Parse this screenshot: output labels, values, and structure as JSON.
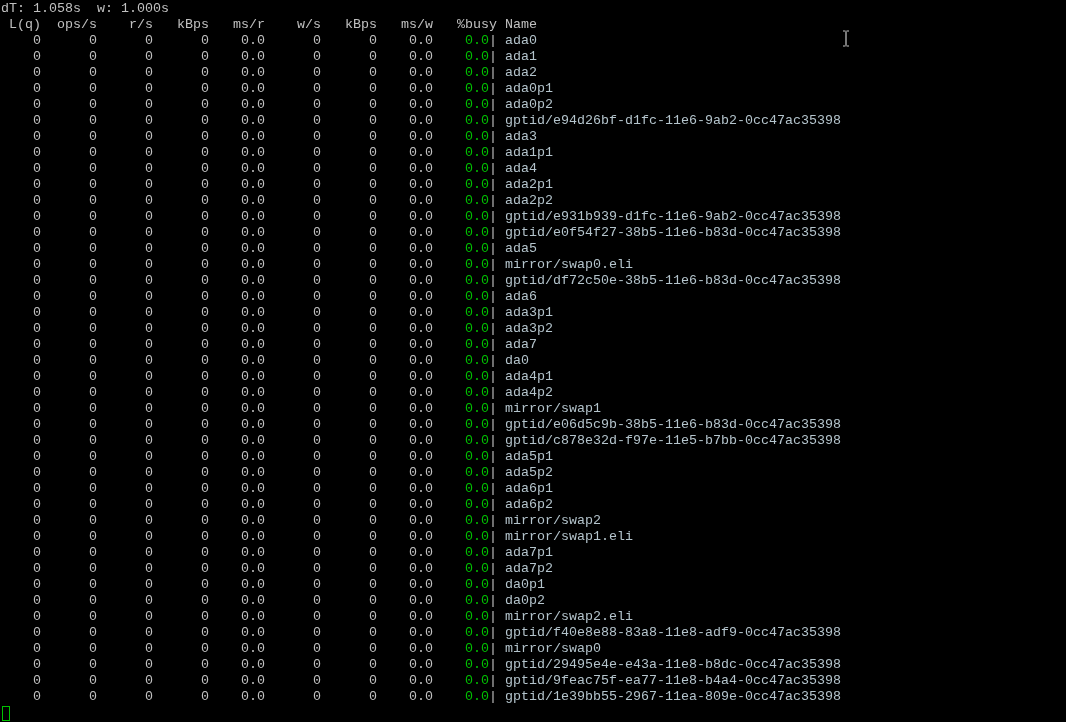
{
  "status_line": {
    "interval": "dT: 1.058s",
    "window": "w: 1.000s"
  },
  "columns": [
    "L(q)",
    "ops/s",
    "r/s",
    "kBps",
    "ms/r",
    "w/s",
    "kBps",
    "ms/w",
    "%busy",
    "Name"
  ],
  "rows": [
    {
      "cells": [
        "0",
        "0",
        "0",
        "0",
        "0.0",
        "0",
        "0",
        "0.0",
        "0.0"
      ],
      "sep": "|",
      "name": "ada0"
    },
    {
      "cells": [
        "0",
        "0",
        "0",
        "0",
        "0.0",
        "0",
        "0",
        "0.0",
        "0.0"
      ],
      "sep": "|",
      "name": "ada1"
    },
    {
      "cells": [
        "0",
        "0",
        "0",
        "0",
        "0.0",
        "0",
        "0",
        "0.0",
        "0.0"
      ],
      "sep": "|",
      "name": "ada2"
    },
    {
      "cells": [
        "0",
        "0",
        "0",
        "0",
        "0.0",
        "0",
        "0",
        "0.0",
        "0.0"
      ],
      "sep": "|",
      "name": "ada0p1"
    },
    {
      "cells": [
        "0",
        "0",
        "0",
        "0",
        "0.0",
        "0",
        "0",
        "0.0",
        "0.0"
      ],
      "sep": "|",
      "name": "ada0p2"
    },
    {
      "cells": [
        "0",
        "0",
        "0",
        "0",
        "0.0",
        "0",
        "0",
        "0.0",
        "0.0"
      ],
      "sep": "|",
      "name": "gptid/e94d26bf-d1fc-11e6-9ab2-0cc47ac35398"
    },
    {
      "cells": [
        "0",
        "0",
        "0",
        "0",
        "0.0",
        "0",
        "0",
        "0.0",
        "0.0"
      ],
      "sep": "|",
      "name": "ada3"
    },
    {
      "cells": [
        "0",
        "0",
        "0",
        "0",
        "0.0",
        "0",
        "0",
        "0.0",
        "0.0"
      ],
      "sep": "|",
      "name": "ada1p1"
    },
    {
      "cells": [
        "0",
        "0",
        "0",
        "0",
        "0.0",
        "0",
        "0",
        "0.0",
        "0.0"
      ],
      "sep": "|",
      "name": "ada4"
    },
    {
      "cells": [
        "0",
        "0",
        "0",
        "0",
        "0.0",
        "0",
        "0",
        "0.0",
        "0.0"
      ],
      "sep": "|",
      "name": "ada2p1"
    },
    {
      "cells": [
        "0",
        "0",
        "0",
        "0",
        "0.0",
        "0",
        "0",
        "0.0",
        "0.0"
      ],
      "sep": "|",
      "name": "ada2p2"
    },
    {
      "cells": [
        "0",
        "0",
        "0",
        "0",
        "0.0",
        "0",
        "0",
        "0.0",
        "0.0"
      ],
      "sep": "|",
      "name": "gptid/e931b939-d1fc-11e6-9ab2-0cc47ac35398"
    },
    {
      "cells": [
        "0",
        "0",
        "0",
        "0",
        "0.0",
        "0",
        "0",
        "0.0",
        "0.0"
      ],
      "sep": "|",
      "name": "gptid/e0f54f27-38b5-11e6-b83d-0cc47ac35398"
    },
    {
      "cells": [
        "0",
        "0",
        "0",
        "0",
        "0.0",
        "0",
        "0",
        "0.0",
        "0.0"
      ],
      "sep": "|",
      "name": "ada5"
    },
    {
      "cells": [
        "0",
        "0",
        "0",
        "0",
        "0.0",
        "0",
        "0",
        "0.0",
        "0.0"
      ],
      "sep": "|",
      "name": "mirror/swap0.eli"
    },
    {
      "cells": [
        "0",
        "0",
        "0",
        "0",
        "0.0",
        "0",
        "0",
        "0.0",
        "0.0"
      ],
      "sep": "|",
      "name": "gptid/df72c50e-38b5-11e6-b83d-0cc47ac35398"
    },
    {
      "cells": [
        "0",
        "0",
        "0",
        "0",
        "0.0",
        "0",
        "0",
        "0.0",
        "0.0"
      ],
      "sep": "|",
      "name": "ada6"
    },
    {
      "cells": [
        "0",
        "0",
        "0",
        "0",
        "0.0",
        "0",
        "0",
        "0.0",
        "0.0"
      ],
      "sep": "|",
      "name": "ada3p1"
    },
    {
      "cells": [
        "0",
        "0",
        "0",
        "0",
        "0.0",
        "0",
        "0",
        "0.0",
        "0.0"
      ],
      "sep": "|",
      "name": "ada3p2"
    },
    {
      "cells": [
        "0",
        "0",
        "0",
        "0",
        "0.0",
        "0",
        "0",
        "0.0",
        "0.0"
      ],
      "sep": "|",
      "name": "ada7"
    },
    {
      "cells": [
        "0",
        "0",
        "0",
        "0",
        "0.0",
        "0",
        "0",
        "0.0",
        "0.0"
      ],
      "sep": "|",
      "name": "da0"
    },
    {
      "cells": [
        "0",
        "0",
        "0",
        "0",
        "0.0",
        "0",
        "0",
        "0.0",
        "0.0"
      ],
      "sep": "|",
      "name": "ada4p1"
    },
    {
      "cells": [
        "0",
        "0",
        "0",
        "0",
        "0.0",
        "0",
        "0",
        "0.0",
        "0.0"
      ],
      "sep": "|",
      "name": "ada4p2"
    },
    {
      "cells": [
        "0",
        "0",
        "0",
        "0",
        "0.0",
        "0",
        "0",
        "0.0",
        "0.0"
      ],
      "sep": "|",
      "name": "mirror/swap1"
    },
    {
      "cells": [
        "0",
        "0",
        "0",
        "0",
        "0.0",
        "0",
        "0",
        "0.0",
        "0.0"
      ],
      "sep": "|",
      "name": "gptid/e06d5c9b-38b5-11e6-b83d-0cc47ac35398"
    },
    {
      "cells": [
        "0",
        "0",
        "0",
        "0",
        "0.0",
        "0",
        "0",
        "0.0",
        "0.0"
      ],
      "sep": "|",
      "name": "gptid/c878e32d-f97e-11e5-b7bb-0cc47ac35398"
    },
    {
      "cells": [
        "0",
        "0",
        "0",
        "0",
        "0.0",
        "0",
        "0",
        "0.0",
        "0.0"
      ],
      "sep": "|",
      "name": "ada5p1"
    },
    {
      "cells": [
        "0",
        "0",
        "0",
        "0",
        "0.0",
        "0",
        "0",
        "0.0",
        "0.0"
      ],
      "sep": "|",
      "name": "ada5p2"
    },
    {
      "cells": [
        "0",
        "0",
        "0",
        "0",
        "0.0",
        "0",
        "0",
        "0.0",
        "0.0"
      ],
      "sep": "|",
      "name": "ada6p1"
    },
    {
      "cells": [
        "0",
        "0",
        "0",
        "0",
        "0.0",
        "0",
        "0",
        "0.0",
        "0.0"
      ],
      "sep": "|",
      "name": "ada6p2"
    },
    {
      "cells": [
        "0",
        "0",
        "0",
        "0",
        "0.0",
        "0",
        "0",
        "0.0",
        "0.0"
      ],
      "sep": "|",
      "name": "mirror/swap2"
    },
    {
      "cells": [
        "0",
        "0",
        "0",
        "0",
        "0.0",
        "0",
        "0",
        "0.0",
        "0.0"
      ],
      "sep": "|",
      "name": "mirror/swap1.eli"
    },
    {
      "cells": [
        "0",
        "0",
        "0",
        "0",
        "0.0",
        "0",
        "0",
        "0.0",
        "0.0"
      ],
      "sep": "|",
      "name": "ada7p1"
    },
    {
      "cells": [
        "0",
        "0",
        "0",
        "0",
        "0.0",
        "0",
        "0",
        "0.0",
        "0.0"
      ],
      "sep": "|",
      "name": "ada7p2"
    },
    {
      "cells": [
        "0",
        "0",
        "0",
        "0",
        "0.0",
        "0",
        "0",
        "0.0",
        "0.0"
      ],
      "sep": "|",
      "name": "da0p1"
    },
    {
      "cells": [
        "0",
        "0",
        "0",
        "0",
        "0.0",
        "0",
        "0",
        "0.0",
        "0.0"
      ],
      "sep": "|",
      "name": "da0p2"
    },
    {
      "cells": [
        "0",
        "0",
        "0",
        "0",
        "0.0",
        "0",
        "0",
        "0.0",
        "0.0"
      ],
      "sep": "|",
      "name": "mirror/swap2.eli"
    },
    {
      "cells": [
        "0",
        "0",
        "0",
        "0",
        "0.0",
        "0",
        "0",
        "0.0",
        "0.0"
      ],
      "sep": "|",
      "name": "gptid/f40e8e88-83a8-11e8-adf9-0cc47ac35398"
    },
    {
      "cells": [
        "0",
        "0",
        "0",
        "0",
        "0.0",
        "0",
        "0",
        "0.0",
        "0.0"
      ],
      "sep": "|",
      "name": "mirror/swap0"
    },
    {
      "cells": [
        "0",
        "0",
        "0",
        "0",
        "0.0",
        "0",
        "0",
        "0.0",
        "0.0"
      ],
      "sep": "|",
      "name": "gptid/29495e4e-e43a-11e8-b8dc-0cc47ac35398"
    },
    {
      "cells": [
        "0",
        "0",
        "0",
        "0",
        "0.0",
        "0",
        "0",
        "0.0",
        "0.0"
      ],
      "sep": "|",
      "name": "gptid/9feac75f-ea77-11e8-b4a4-0cc47ac35398"
    },
    {
      "cells": [
        "0",
        "0",
        "0",
        "0",
        "0.0",
        "0",
        "0",
        "0.0",
        "0.0"
      ],
      "sep": "|",
      "name": "gptid/1e39bb55-2967-11ea-809e-0cc47ac35398"
    }
  ]
}
